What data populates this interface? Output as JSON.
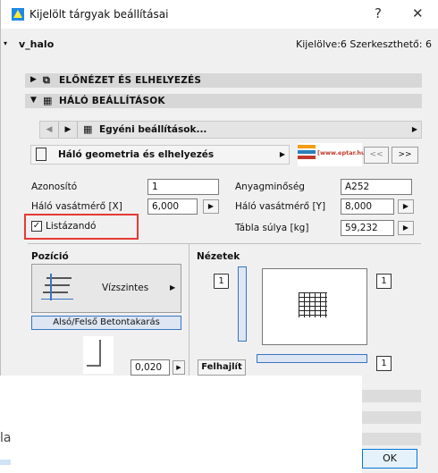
{
  "window": {
    "title": "Kijelölt tárgyak beállításai",
    "help_label": "?",
    "close_label": "✕"
  },
  "header": {
    "object_name": "v_halo",
    "selection_status": "Kijelölve:6 Szerkeszthető: 6"
  },
  "sections": [
    {
      "label": "ELŐNÉZET ÉS ELHELYEZÉS",
      "expanded": false,
      "icon": "preview-icon"
    },
    {
      "label": "HÁLÓ BEÁLLÍTÁSOK",
      "expanded": true,
      "icon": "mesh-settings-icon"
    }
  ],
  "custom_settings": {
    "label": "Egyéni beállítások..."
  },
  "geometry_bar": {
    "label": "Háló geometria és elhelyezés",
    "logo_text": "[www.eptar.hu]",
    "prev_label": "<<",
    "next_label": ">>"
  },
  "form": {
    "azonosito_label": "Azonosító",
    "azonosito_value": "1",
    "vasatmero_x_label": "Háló vasátmérő [X]",
    "vasatmero_x_value": "6,000",
    "listazando_label": "Listázandó",
    "listazando_checked": true,
    "anyagminoseg_label": "Anyagminőség",
    "anyagminoseg_value": "A252",
    "vasatmero_y_label": "Háló vasátmérő [Y]",
    "vasatmero_y_value": "8,000",
    "tabla_sulya_label": "Tábla súlya [kg]",
    "tabla_sulya_value": "59,232"
  },
  "pozicio": {
    "title": "Pozíció",
    "orientation_label": "Vízszintes",
    "cover_button_label": "Alsó/Felső Betontakarás",
    "offset_value": "0,020"
  },
  "nezetek": {
    "title": "Nézetek",
    "badge_1": "1",
    "badge_2": "1",
    "badge_3": "1",
    "flip_button_label": "Felhajlít"
  },
  "footer": {
    "ok_label": "OK",
    "peek_text": "la"
  },
  "colors": {
    "highlight_box": "#e53935",
    "section_bg": "#d7d7d7",
    "cover_button_border": "#3a74c4"
  }
}
